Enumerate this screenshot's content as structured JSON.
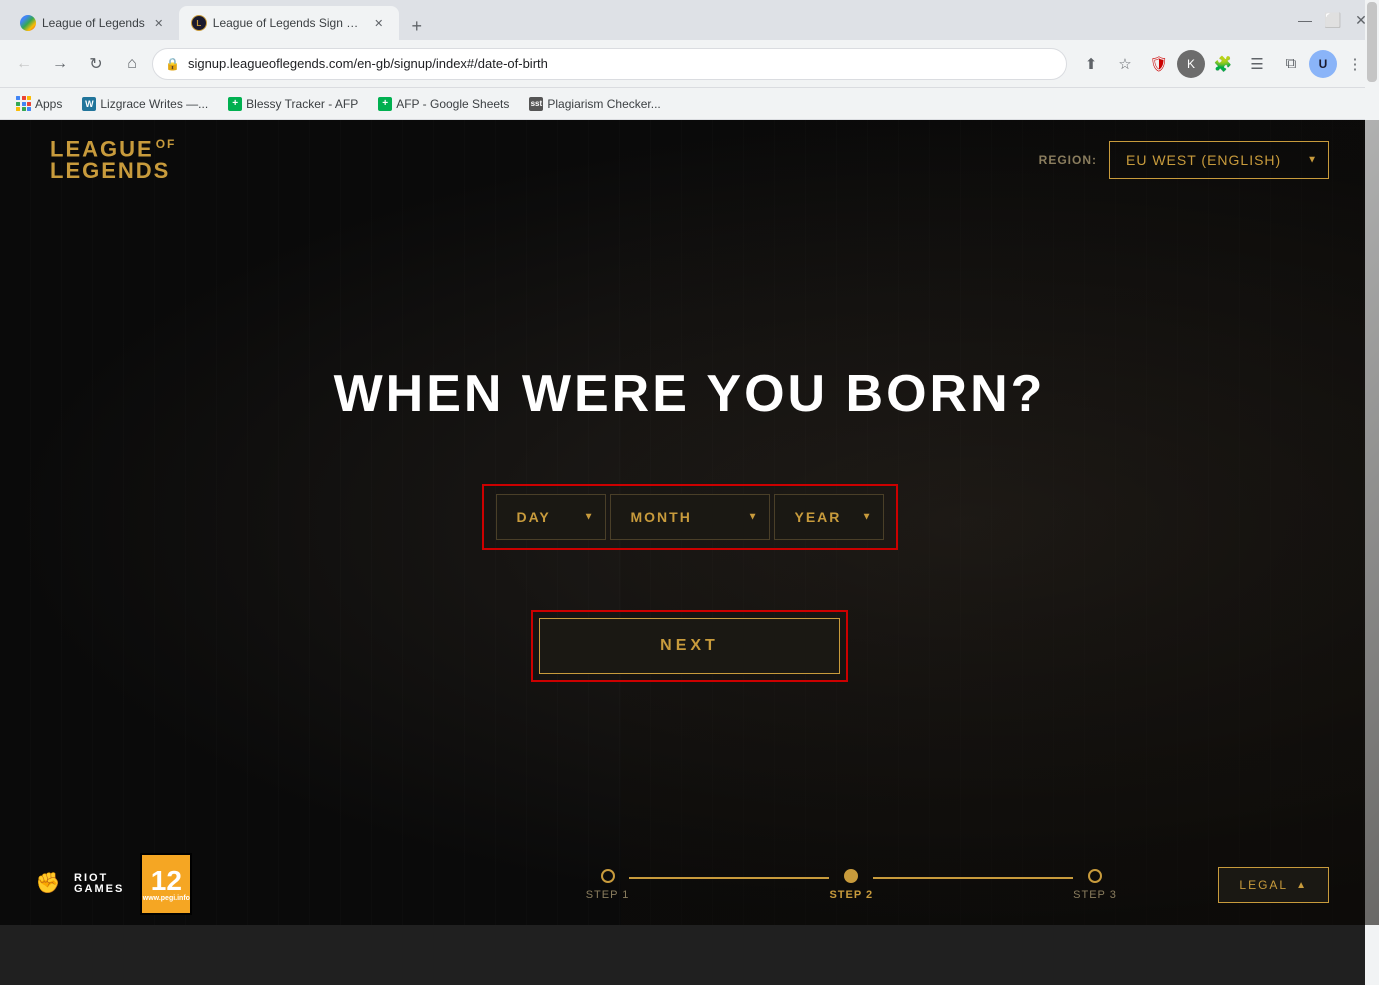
{
  "browser": {
    "tabs": [
      {
        "id": "tab1",
        "title": "League of Legends",
        "favicon_type": "chrome",
        "active": false
      },
      {
        "id": "tab2",
        "title": "League of Legends Sign Up | EU",
        "favicon_type": "lol",
        "active": true
      }
    ],
    "url": "signup.leagueoflegends.com/en-gb/signup/index#/date-of-birth",
    "bookmarks": [
      {
        "id": "apps",
        "label": "Apps",
        "type": "apps"
      },
      {
        "id": "lizgrace",
        "label": "Lizgrace Writes —...",
        "type": "wordpress"
      },
      {
        "id": "blessy",
        "label": "Blessy Tracker - AFP",
        "type": "plus"
      },
      {
        "id": "afp",
        "label": "AFP - Google Sheets",
        "type": "plus"
      },
      {
        "id": "plagiarism",
        "label": "Plagiarism Checker...",
        "type": "sst"
      }
    ]
  },
  "page": {
    "logo_top": "LEAGUE",
    "logo_of": "OF",
    "logo_bottom": "LEGENDS",
    "region_label": "REGION:",
    "region_value": "EU WEST (ENGLISH)",
    "main_title": "WHEN WERE YOU BORN?",
    "day_label": "DAY",
    "month_label": "MONTH",
    "year_label": "YEAR",
    "next_label": "NEXT",
    "steps": [
      {
        "id": "step1",
        "label": "STEP 1",
        "active": false
      },
      {
        "id": "step2",
        "label": "STEP 2",
        "active": true
      },
      {
        "id": "step3",
        "label": "STEP 3",
        "active": false
      }
    ],
    "legal_label": "LEGAL",
    "riot_top": "RIOT",
    "riot_bottom": "GAMES",
    "pegi_number": "12",
    "pegi_sub": "www.pegi.info"
  }
}
